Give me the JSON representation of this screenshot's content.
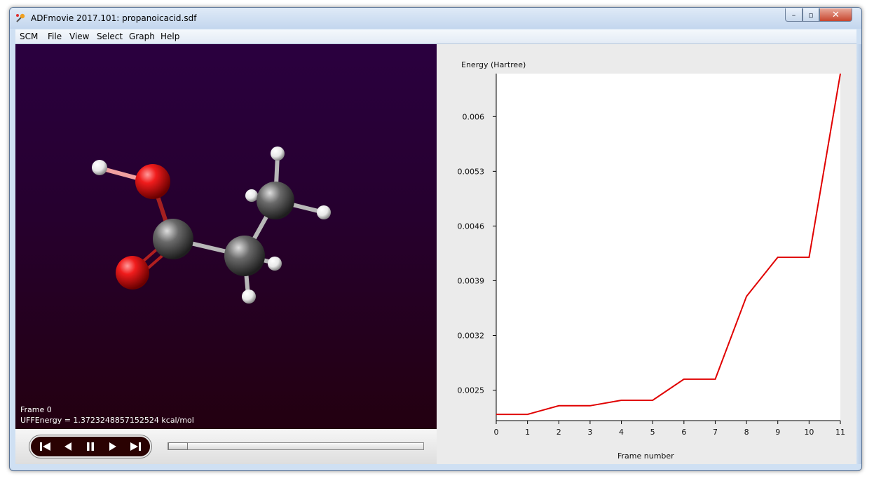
{
  "window": {
    "title": "ADFmovie 2017.101: propanoicacid.sdf",
    "minimize_glyph": "–",
    "maximize_glyph": "▫",
    "close_glyph": "✕"
  },
  "menu": [
    "SCM",
    "File",
    "View",
    "Select",
    "Graph",
    "Help"
  ],
  "viewer": {
    "frame_label": "Frame 0",
    "energy_label": "UFFEnergy = 1.3723248857152524 kcal/mol"
  },
  "playback": {
    "buttons": [
      "skip-to-start-icon",
      "step-back-icon",
      "pause-icon",
      "play-icon",
      "skip-to-end-icon"
    ],
    "slider_position": 0
  },
  "colors": {
    "line": "#e00000",
    "oxygen": "#e01818",
    "carbon": "#5a5a5a",
    "hydrogen": "#f2f2f2"
  },
  "chart_data": {
    "type": "line",
    "ylabel": "Energy (Hartree)",
    "xlabel": "Frame number",
    "x": [
      0,
      1,
      2,
      3,
      4,
      5,
      6,
      7,
      8,
      9,
      10,
      11
    ],
    "values": [
      0.00219,
      0.00219,
      0.0023,
      0.0023,
      0.00237,
      0.00237,
      0.00264,
      0.00264,
      0.0037,
      0.0042,
      0.0042,
      0.00655
    ],
    "xlim": [
      0,
      11
    ],
    "ylim": [
      0.00211,
      0.00655
    ],
    "x_ticks": [
      "0",
      "1",
      "2",
      "3",
      "4",
      "5",
      "6",
      "7",
      "8",
      "9",
      "10",
      "11"
    ],
    "y_ticks": [
      {
        "value": 0.006,
        "label": "0.006"
      },
      {
        "value": 0.0053,
        "label": "0.0053"
      },
      {
        "value": 0.0046,
        "label": "0.0046"
      },
      {
        "value": 0.0039,
        "label": "0.0039"
      },
      {
        "value": 0.0032,
        "label": "0.0032"
      },
      {
        "value": 0.0025,
        "label": "0.0025"
      }
    ]
  }
}
